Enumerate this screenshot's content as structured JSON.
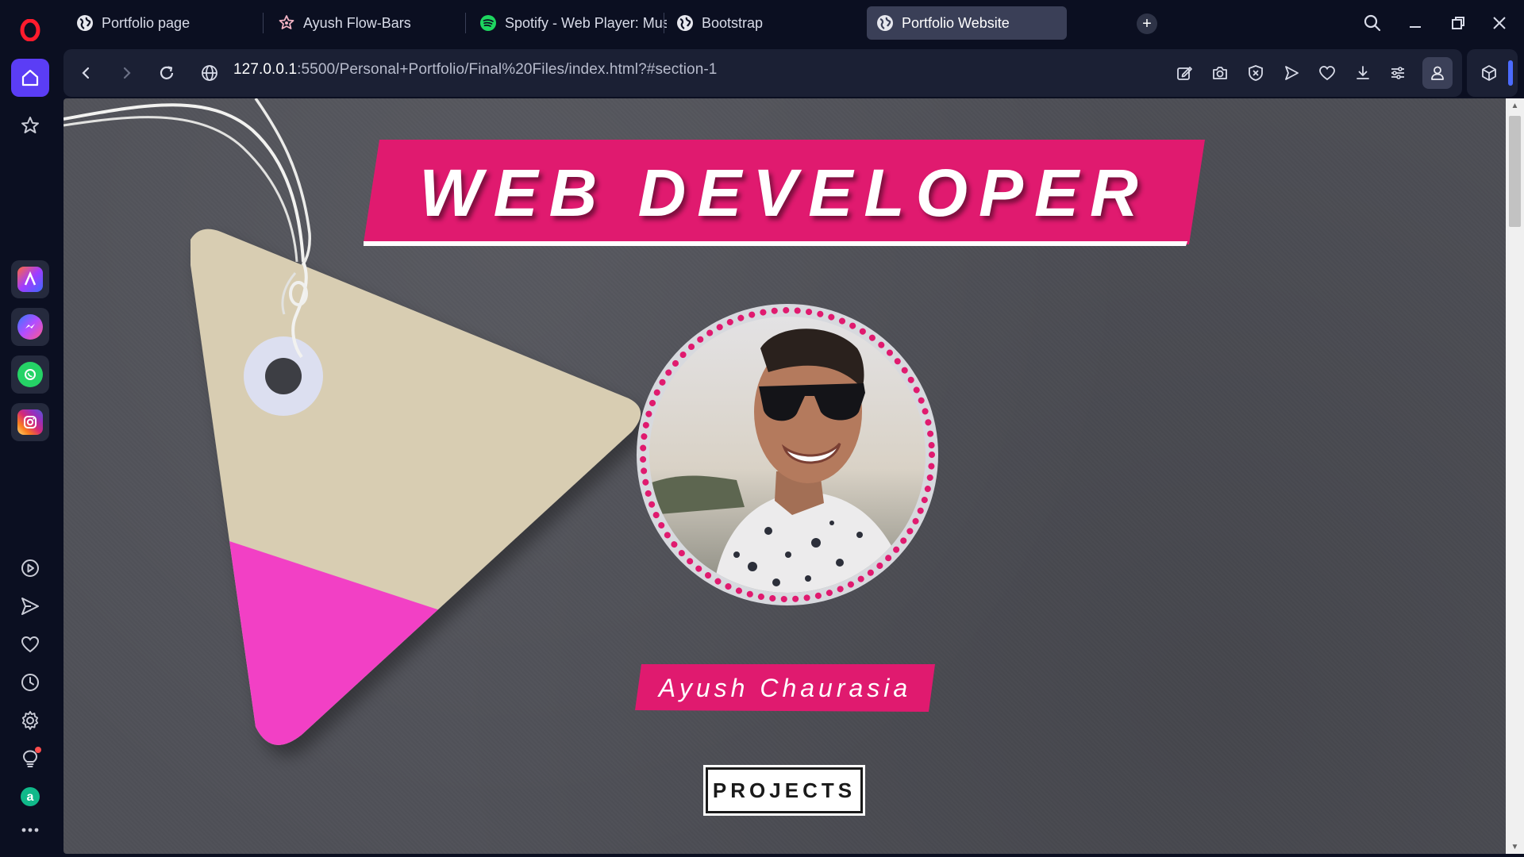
{
  "browser": {
    "tabs": [
      {
        "label": "Portfolio page",
        "icon": "globe-icon",
        "active": false
      },
      {
        "label": "Ayush Flow-Bars",
        "icon": "flower-icon",
        "active": false
      },
      {
        "label": "Spotify - Web Player: Mus",
        "icon": "spotify-icon",
        "active": false
      },
      {
        "label": "Bootstrap",
        "icon": "globe-icon",
        "active": false
      },
      {
        "label": "Portfolio Website",
        "icon": "globe-icon",
        "active": true
      }
    ],
    "new_tab_label": "+",
    "url_host": "127.0.0.1",
    "url_rest": ":5500/Personal+Portfolio/Final%20Files/index.html?#section-1"
  },
  "sidebar": {
    "items": [
      {
        "name": "opera-logo-icon"
      },
      {
        "name": "home-icon"
      },
      {
        "name": "bookmarks-icon"
      },
      {
        "name": "aria-app-icon"
      },
      {
        "name": "messenger-app-icon"
      },
      {
        "name": "whatsapp-app-icon"
      },
      {
        "name": "instagram-app-icon"
      },
      {
        "name": "player-icon"
      },
      {
        "name": "send-icon"
      },
      {
        "name": "heart-icon"
      },
      {
        "name": "history-icon"
      },
      {
        "name": "settings-icon"
      },
      {
        "name": "lightbulb-icon"
      },
      {
        "name": "amazon-icon"
      },
      {
        "name": "more-icon"
      }
    ]
  },
  "page": {
    "title": "WEB DEVELOPER",
    "name": "Ayush Chaurasia",
    "projects_button": "PROJECTS"
  },
  "colors": {
    "accent_pink": "#e01a6f",
    "tag_pink": "#f23fc5",
    "tag_beige": "#d8cdb2",
    "page_bg": "#4f5057",
    "browser_bg": "#0b0f21",
    "opera_active": "#5b3df5"
  }
}
